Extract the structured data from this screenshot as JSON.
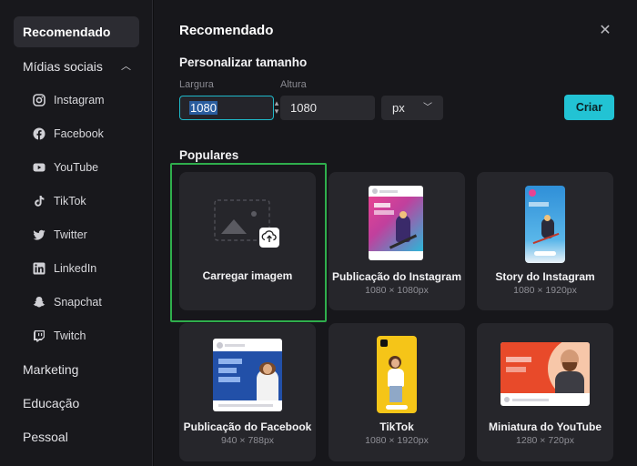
{
  "sidebar": {
    "recommended": "Recomendado",
    "social": "Mídias sociais",
    "social_items": [
      {
        "label": "Instagram",
        "icon": "instagram-icon"
      },
      {
        "label": "Facebook",
        "icon": "facebook-icon"
      },
      {
        "label": "YouTube",
        "icon": "youtube-icon"
      },
      {
        "label": "TikTok",
        "icon": "tiktok-icon"
      },
      {
        "label": "Twitter",
        "icon": "twitter-icon"
      },
      {
        "label": "LinkedIn",
        "icon": "linkedin-icon"
      },
      {
        "label": "Snapchat",
        "icon": "snapchat-icon"
      },
      {
        "label": "Twitch",
        "icon": "twitch-icon"
      }
    ],
    "marketing": "Marketing",
    "education": "Educação",
    "personal": "Pessoal"
  },
  "main": {
    "title": "Recomendado",
    "custom_size": "Personalizar tamanho",
    "width_label": "Largura",
    "height_label": "Altura",
    "width_value": "1080",
    "height_value": "1080",
    "unit": "px",
    "create_label": "Criar",
    "popular": "Populares"
  },
  "cards": [
    {
      "title": "Carregar imagem",
      "sub": ""
    },
    {
      "title": "Publicação do Instagram",
      "sub": "1080 × 1080px"
    },
    {
      "title": "Story do Instagram",
      "sub": "1080 × 1920px"
    },
    {
      "title": "Publicação do Facebook",
      "sub": "940 × 788px"
    },
    {
      "title": "TikTok",
      "sub": "1080 × 1920px"
    },
    {
      "title": "Miniatura do YouTube",
      "sub": "1280 × 720px"
    }
  ],
  "colors": {
    "accent": "#22c3d4",
    "highlight": "#2fae4c"
  }
}
